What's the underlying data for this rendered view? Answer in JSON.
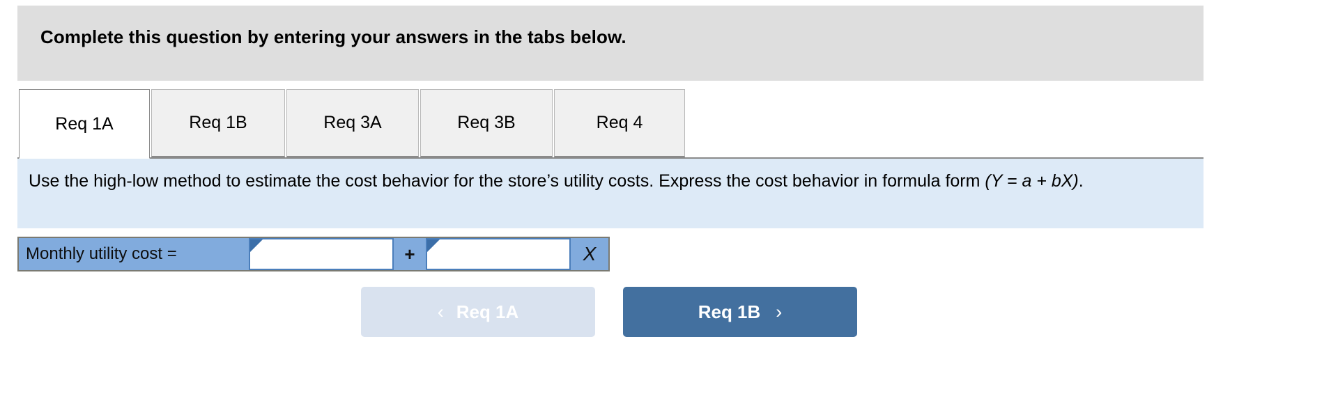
{
  "banner": {
    "instruction": "Complete this question by entering your answers in the tabs below."
  },
  "tabs": [
    {
      "label": "Req 1A",
      "active": true
    },
    {
      "label": "Req 1B",
      "active": false
    },
    {
      "label": "Req 3A",
      "active": false
    },
    {
      "label": "Req 3B",
      "active": false
    },
    {
      "label": "Req 4",
      "active": false
    }
  ],
  "question": {
    "line1": "Use the high-low method to estimate the cost behavior for the store’s utility costs. Express the cost behavior in formula form",
    "formula": "(Y = a + bX)",
    "period": "."
  },
  "answer": {
    "label": "Monthly utility cost =",
    "intercept_value": "",
    "intercept_placeholder": "",
    "operator": "+",
    "slope_value": "",
    "slope_placeholder": "",
    "variable": "X"
  },
  "navigation": {
    "prev_label": "Req 1A",
    "prev_icon": "chevron-left-icon",
    "prev_chevron": "‹",
    "next_label": "Req 1B",
    "next_icon": "chevron-right-icon",
    "next_chevron": "›"
  },
  "colors": {
    "banner_bg": "#dedede",
    "question_bg": "#ddeaf7",
    "row_blue": "#81abdd",
    "input_border": "#4a7ebb",
    "flag_blue": "#3b6ea8",
    "next_button": "#43709f",
    "prev_button": "#d9e2ef"
  }
}
